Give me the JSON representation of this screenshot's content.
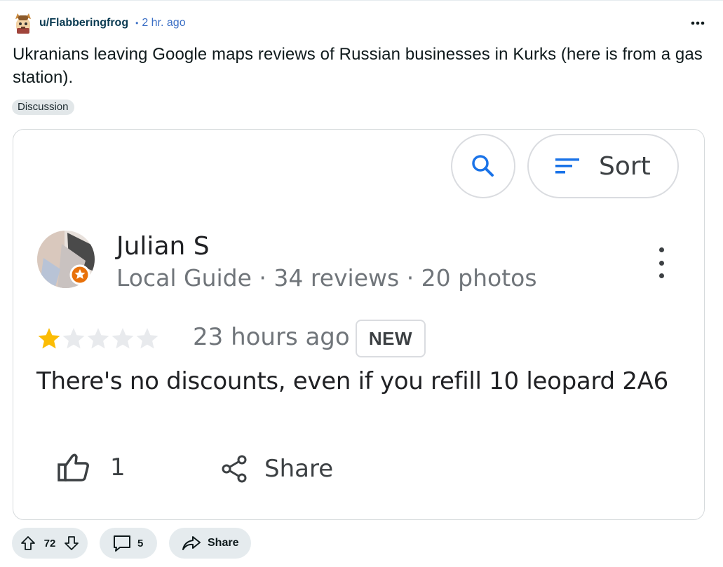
{
  "post": {
    "username": "u/Flabberingfrog",
    "separator": "•",
    "time": "2 hr. ago",
    "title": "Ukranians leaving Google maps reviews of Russian businesses in Kurks (here is from a gas station).",
    "flair": "Discussion",
    "more_icon": "ellipsis-icon",
    "avatar_icon": "cartoon-avatar-icon"
  },
  "review": {
    "search_icon": "search-icon",
    "sort_label": "Sort",
    "reviewer_name": "Julian S",
    "reviewer_meta": "Local Guide · 34 reviews · 20 photos",
    "rating": 1,
    "rating_max": 5,
    "time": "23 hours ago",
    "badge": "NEW",
    "text": "There's no discounts, even if you refill 10 leopard 2A6",
    "likes": "1",
    "share_label": "Share",
    "star_color": "#fbbc04",
    "star_empty_color": "#e8eaed"
  },
  "actions": {
    "votes": "72",
    "comments": "5",
    "share_label": "Share"
  }
}
